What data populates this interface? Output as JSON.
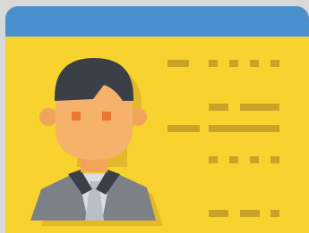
{
  "image": {
    "subject": "id-card-icon",
    "colors": {
      "background": "#d9d9d9",
      "card": "#f8d330",
      "header": "#4a90cf",
      "shadow": "#e3b82a",
      "text_bar": "#c9a328",
      "hair": "#3b3f47",
      "skin": "#f6b26b",
      "eyes": "#e8762c",
      "shirt": "#d8dde3",
      "jacket": "#7c8087",
      "collar": "#3b3f47"
    }
  }
}
